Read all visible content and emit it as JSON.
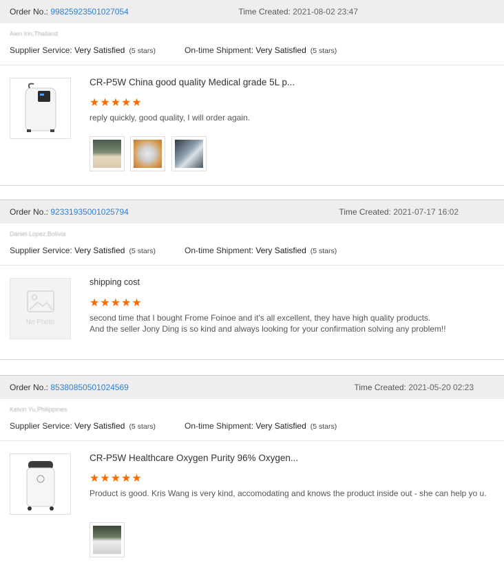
{
  "labels": {
    "order_no": "Order No.:",
    "time_created": "Time Created:",
    "supplier_service": "Supplier Service:",
    "ontime_shipment": "On-time Shipment:",
    "stars_text": "(5 stars)",
    "stars_glyph": "★★★★★",
    "no_photo": "No Photo"
  },
  "reviews": [
    {
      "order_no": "99825923501027054",
      "time": "2021-08-02 23:47",
      "buyer": "Aien Irin,Thailand",
      "supplier_service": "Very Satisfied",
      "ontime_shipment": "Very Satisfied",
      "product_title": "CR-P5W China good quality Medical grade 5L p...",
      "rating": 5,
      "text": "reply quickly, good quality, I will order again.",
      "has_photo": true
    },
    {
      "order_no": "92331935001025794",
      "time": "2021-07-17 16:02",
      "buyer": "Daniel Lopez,Bolivia",
      "supplier_service": "Very Satisfied",
      "ontime_shipment": "Very Satisfied",
      "product_title": "shipping cost",
      "rating": 5,
      "text": "second time that I bought Frome Foinoe and it's all excellent, they have high quality products.\nAnd  the seller Jony Ding is so kind and always looking for your confirmation solving any problem!!",
      "has_photo": false
    },
    {
      "order_no": "85380850501024569",
      "time": "2021-05-20 02:23",
      "buyer": "Kelvin Yu,Philippines",
      "supplier_service": "Very Satisfied",
      "ontime_shipment": "Very Satisfied",
      "product_title": "CR-P5W Healthcare Oxygen Purity 96% Oxygen...",
      "rating": 5,
      "text": "Product is good.  Kris Wang is very kind, accomodating and knows the product inside out - she can help yo u.",
      "has_photo": true
    }
  ]
}
